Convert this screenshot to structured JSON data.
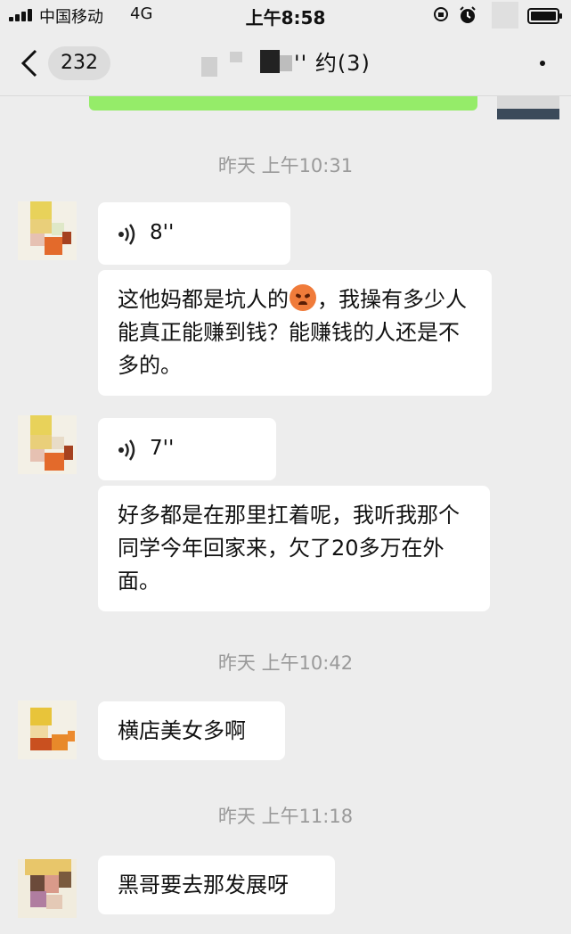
{
  "status_bar": {
    "carrier": "中国移动",
    "network": "4G",
    "time": "上午8:58"
  },
  "nav": {
    "back_badge": "232",
    "title": "'' 约(3)"
  },
  "messages": [
    {
      "type": "time",
      "text": "昨天 上午10:31"
    },
    {
      "type": "voice",
      "duration": "8''"
    },
    {
      "type": "text",
      "text_before": "这他妈都是坑人的",
      "emoji": "angry-face-emoji",
      "text_after": "，我操有多少人能真正能赚到钱？能赚钱的人还是不多的。"
    },
    {
      "type": "voice",
      "duration": "7''"
    },
    {
      "type": "text",
      "text": "好多都是在那里扛着呢，我听我那个同学今年回家来，欠了20多万在外面。"
    },
    {
      "type": "time",
      "text": "昨天 上午10:42"
    },
    {
      "type": "text",
      "text": "横店美女多啊"
    },
    {
      "type": "time",
      "text": "昨天 上午11:18"
    },
    {
      "type": "text",
      "text": "黑哥要去那发展呀"
    }
  ],
  "colors": {
    "background": "#ededed",
    "bubble_incoming": "#ffffff",
    "bubble_outgoing": "#95ec69",
    "timestamp": "#9a9a9a"
  }
}
